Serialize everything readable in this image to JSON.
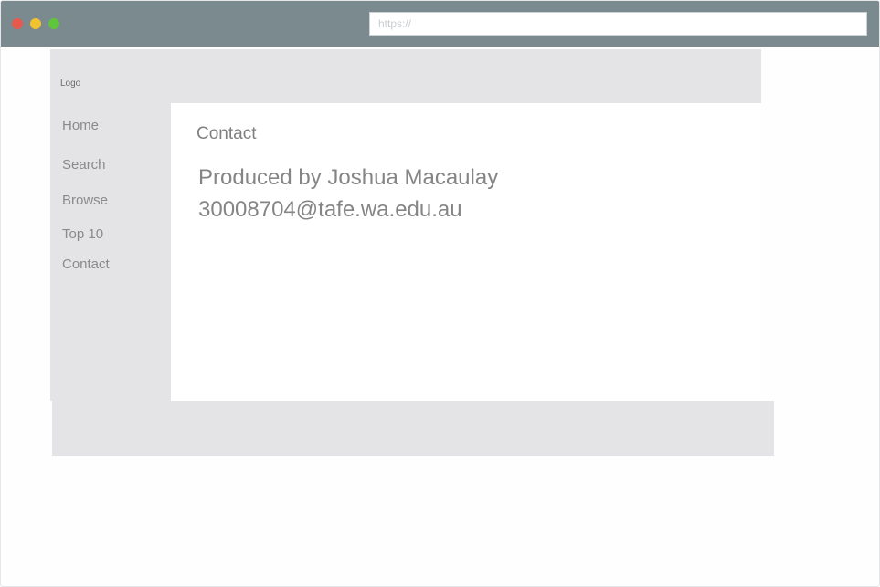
{
  "browser": {
    "url_placeholder": "https://"
  },
  "header": {
    "logo": "Logo"
  },
  "sidebar": {
    "items": [
      {
        "label": "Home"
      },
      {
        "label": "Search"
      },
      {
        "label": "Browse"
      },
      {
        "label": "Top 10"
      },
      {
        "label": "Contact"
      }
    ]
  },
  "main": {
    "title": "Contact",
    "lines": [
      "Produced by Joshua Macaulay",
      "30008704@tafe.wa.edu.au"
    ]
  },
  "colors": {
    "browser_bar": "#7b8a8f",
    "panel": "#e4e4e7",
    "close": "#e8594d",
    "minimize": "#f2c12e",
    "maximize": "#5fc53c"
  }
}
